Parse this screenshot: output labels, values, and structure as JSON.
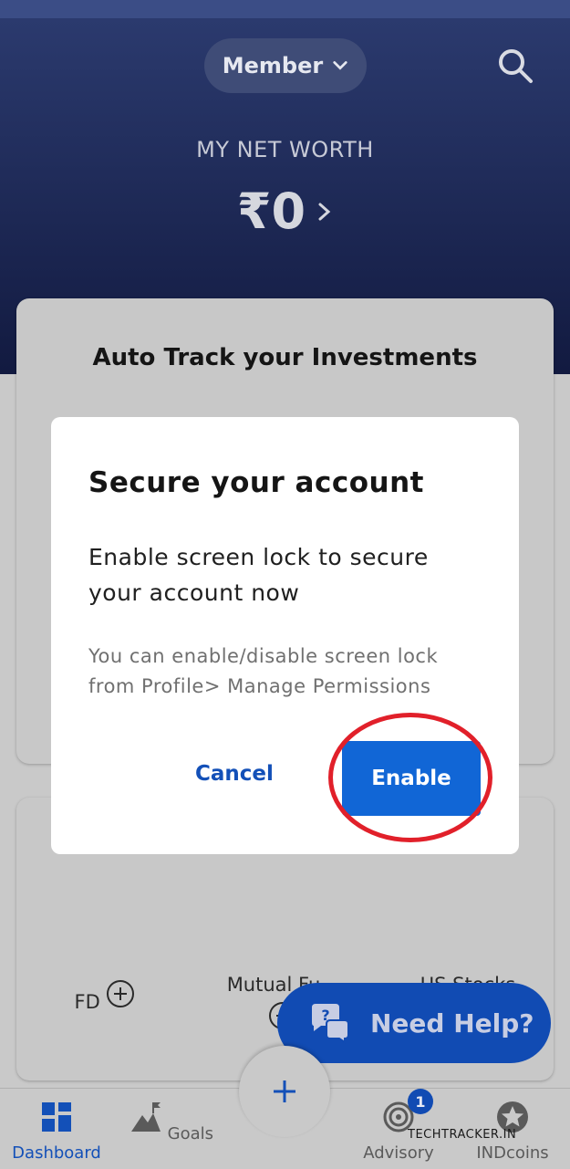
{
  "header": {
    "member_label": "Member",
    "networth_label": "MY NET WORTH",
    "networth_value": "₹0"
  },
  "card1": {
    "title": "Auto Track your Investments"
  },
  "card2": {
    "items": [
      {
        "label": "FD"
      },
      {
        "label": "Mutual Fu..."
      },
      {
        "label": "US Stocks"
      }
    ]
  },
  "fab": {
    "label": "Need Help?"
  },
  "bottom_nav": {
    "items": [
      {
        "label": "Dashboard",
        "icon": "dashboard-icon",
        "active": true
      },
      {
        "label": "Goals",
        "icon": "goals-icon"
      },
      {
        "label": "Advisory",
        "icon": "target-icon",
        "badge": "1"
      },
      {
        "label": "INDcoins",
        "icon": "star-icon"
      }
    ]
  },
  "dialog": {
    "title": "Secure your account",
    "message": "Enable screen lock to secure your account now",
    "hint": "You can enable/disable screen lock from Profile> Manage Permissions",
    "cancel_label": "Cancel",
    "enable_label": "Enable"
  },
  "watermark": "TECHTRACKER.IN",
  "colors": {
    "primary": "#114bb3",
    "highlight": "#e1202a"
  }
}
